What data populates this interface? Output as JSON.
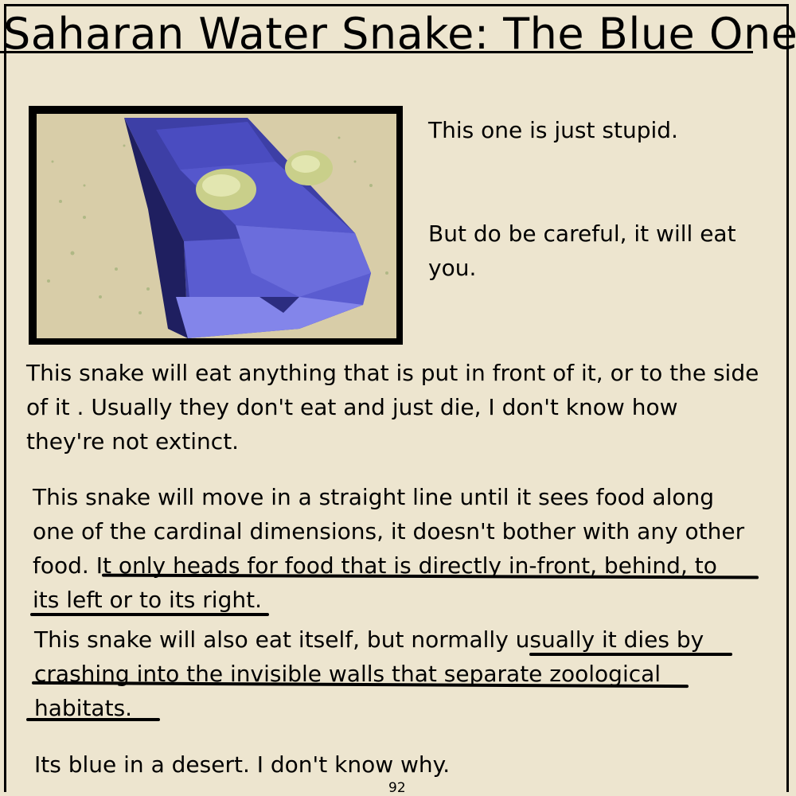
{
  "page": {
    "title": "Saharan Water Snake: The Blue One",
    "page_number": "92"
  },
  "image": {
    "icon": "blue-snake-head-render"
  },
  "side_notes": {
    "line1": "This one is just stupid.",
    "line2a": "But do be careful, it will eat",
    "line2b": "you."
  },
  "paragraph1": {
    "lines": [
      "This snake will eat anything that is put in front of it, or to the side",
      "of it . Usually they don't eat and just die, I don't know how",
      "they're not extinct."
    ]
  },
  "paragraph2": {
    "lines": [
      "This snake will move in a straight line until it sees food along",
      "one of the cardinal dimensions, it doesn't bother with any other",
      "food. It only heads for food that is directly in-front, behind, to",
      "its left or to its right."
    ]
  },
  "paragraph3": {
    "lines": [
      "This snake will also eat itself, but normally usually it dies by",
      "crashing into the invisible walls that separate zoological",
      "habitats."
    ]
  },
  "paragraph4": {
    "text": "Its blue in a desert. I don't know why."
  }
}
